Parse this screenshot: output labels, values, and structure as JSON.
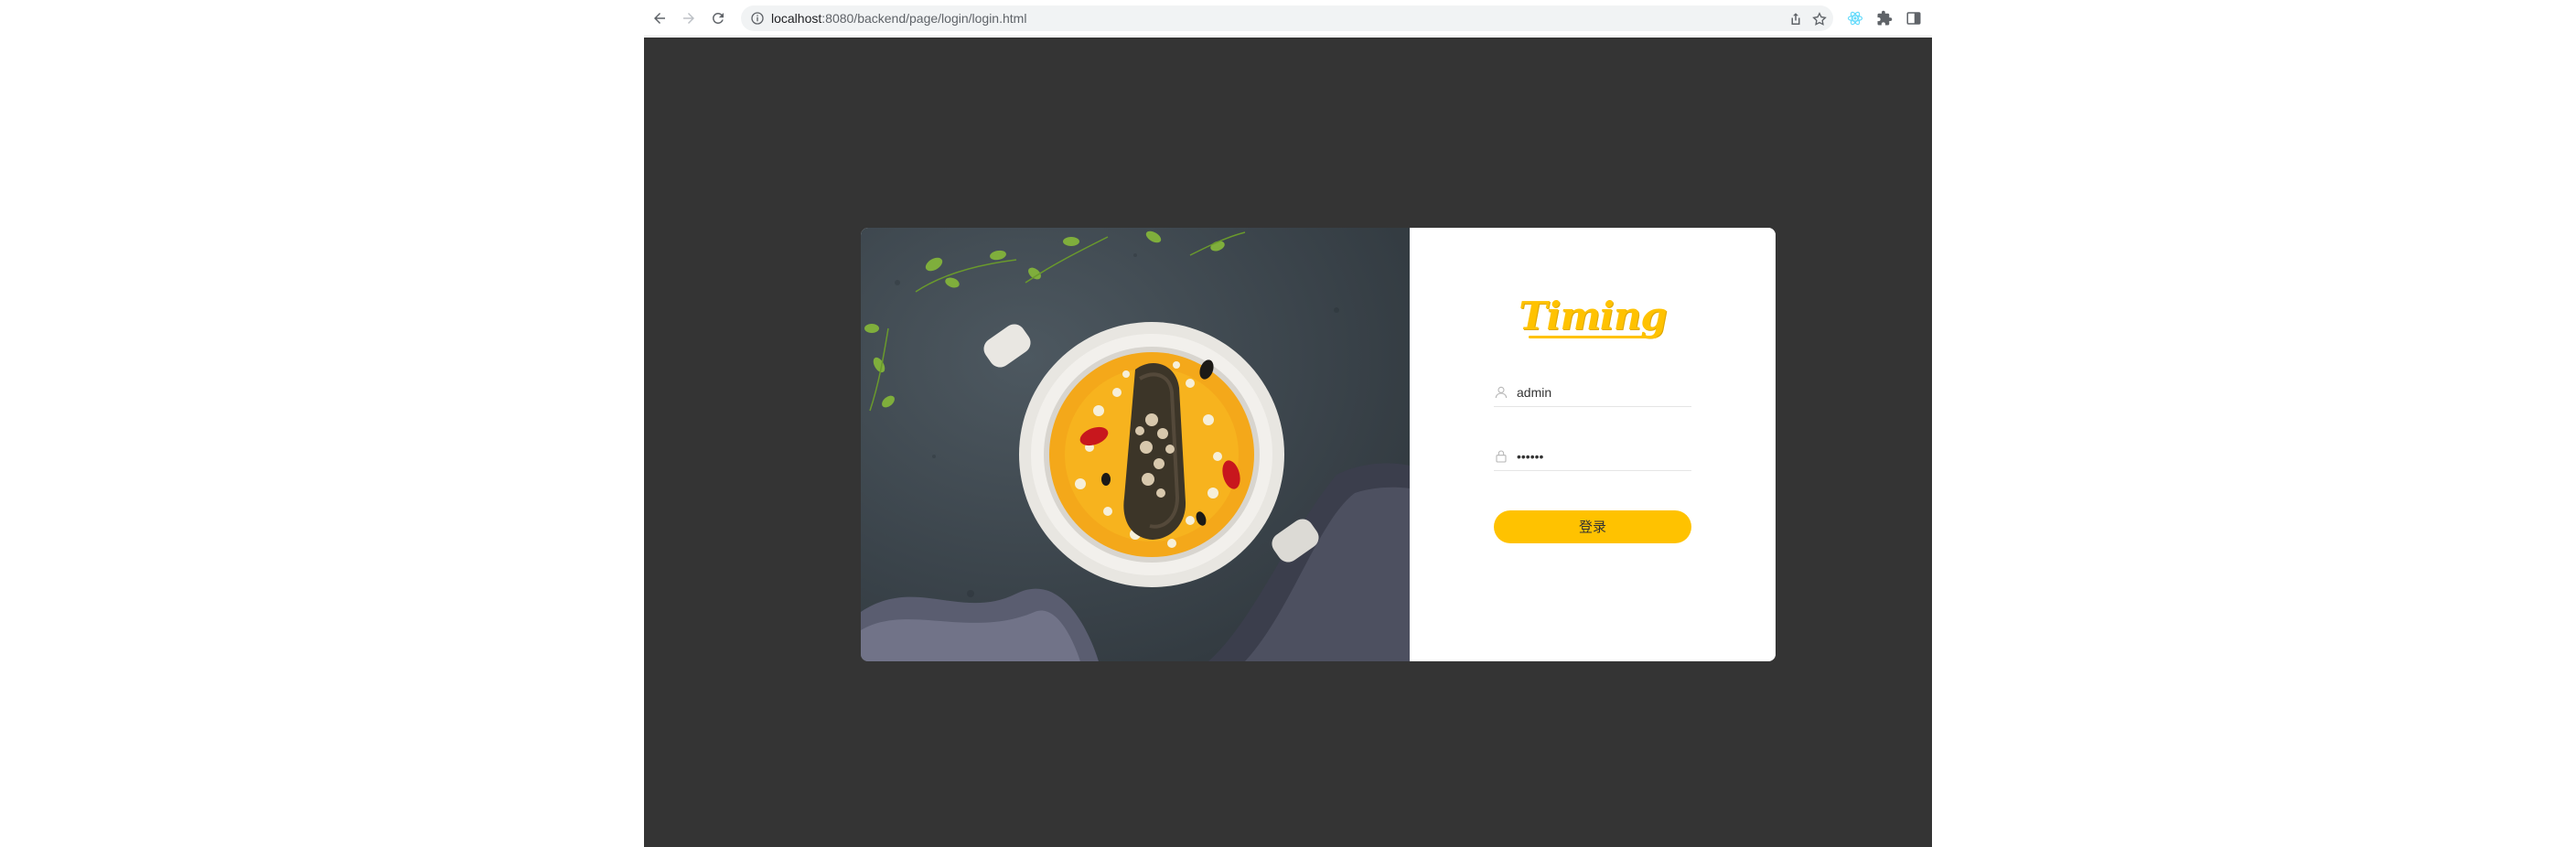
{
  "browser": {
    "url_host": "localhost",
    "url_path": ":8080/backend/page/login/login.html"
  },
  "login": {
    "brand": "Timing",
    "username_value": "admin",
    "password_value": "••••••",
    "submit_label": "登录"
  },
  "colors": {
    "page_background": "#343434",
    "accent": "#ffc200",
    "card": "#ffffff"
  }
}
